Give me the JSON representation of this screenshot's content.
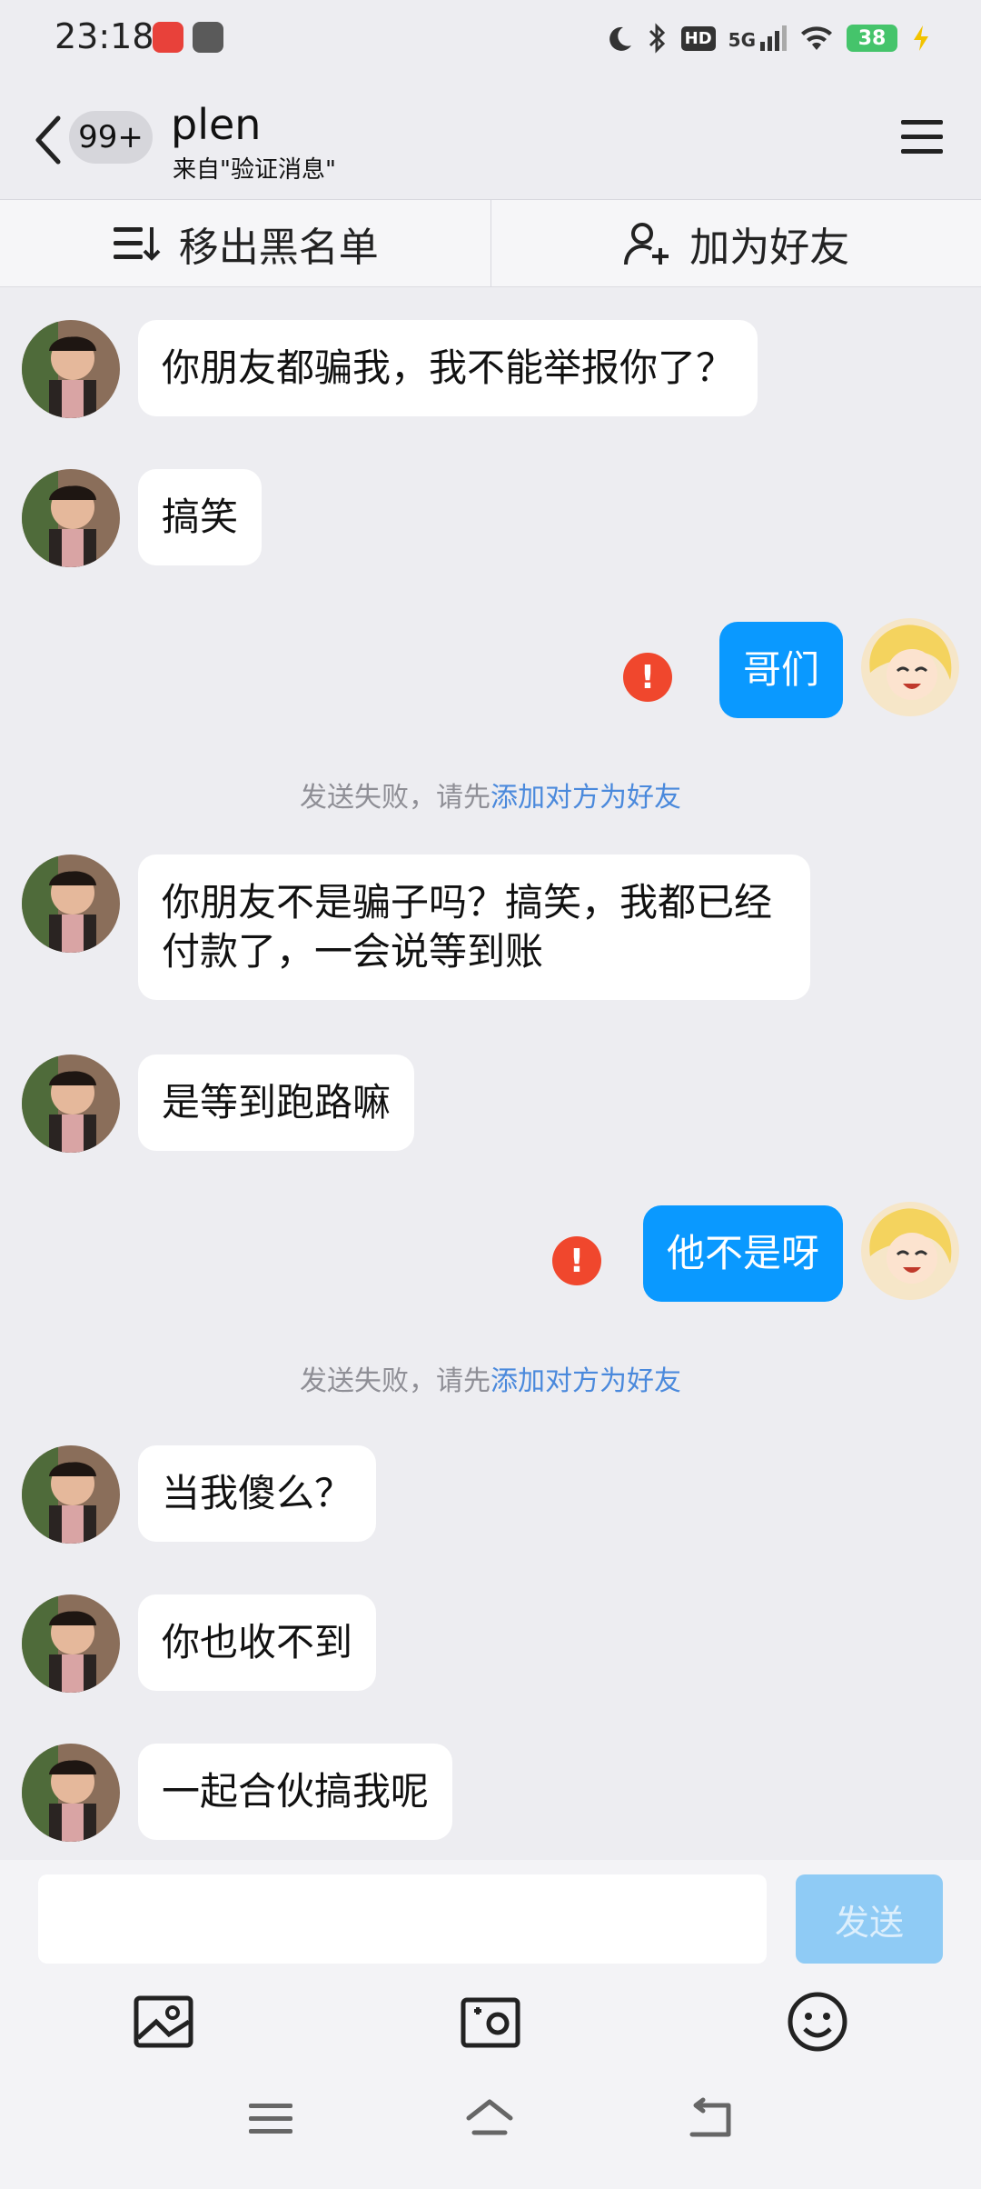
{
  "status_bar": {
    "time": "23:18",
    "network": "5G",
    "hd": "HD",
    "battery": "38"
  },
  "header": {
    "unread_count": "99+",
    "contact_name": "plen",
    "subtitle": "来自\"验证消息\""
  },
  "actions": {
    "remove_blacklist": "移出黑名单",
    "add_friend": "加为好友"
  },
  "messages": [
    {
      "side": "in",
      "text": "你朋友都骗我，我不能举报你了？"
    },
    {
      "side": "in",
      "text": "搞笑"
    },
    {
      "side": "out",
      "text": "哥们",
      "failed": true
    },
    {
      "side": "in",
      "text": "你朋友不是骗子吗？搞笑，我都已经付款了，一会说等到账"
    },
    {
      "side": "in",
      "text": "是等到跑路嘛"
    },
    {
      "side": "out",
      "text": "他不是呀",
      "failed": true
    },
    {
      "side": "in",
      "text": "当我傻么？"
    },
    {
      "side": "in",
      "text": "你也收不到"
    },
    {
      "side": "in",
      "text": "一起合伙搞我呢"
    }
  ],
  "system_note": {
    "prefix": "发送失败，请先",
    "link": "添加对方为好友"
  },
  "composer": {
    "send_label": "发送",
    "input_value": ""
  },
  "colors": {
    "background": "#EDEDF1",
    "outgoing_bubble": "#0A99FF",
    "incoming_bubble": "#FFFFFF",
    "fail_red": "#F0472D",
    "link_blue": "#4A89DC",
    "send_disabled": "#8FCBF5"
  },
  "icons": {
    "tools": [
      "image-icon",
      "camera-icon",
      "emoji-icon"
    ],
    "nav": [
      "menu-nav-icon",
      "home-nav-icon",
      "back-nav-icon"
    ]
  }
}
